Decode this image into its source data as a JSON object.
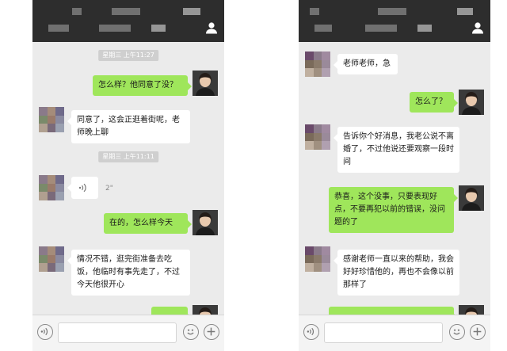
{
  "left_phone": {
    "messages": [
      {
        "kind": "timestamp",
        "text": "星期三 上午11:27"
      },
      {
        "kind": "out",
        "text": "怎么样？他同意了没？"
      },
      {
        "kind": "in",
        "text": "同意了，这会正逛着街呢，老师晚上聊"
      },
      {
        "kind": "timestamp",
        "text": "星期三 上午11:11"
      },
      {
        "kind": "voice",
        "duration": "2\""
      },
      {
        "kind": "out",
        "text": "在的，怎么样今天"
      },
      {
        "kind": "in",
        "text": "情况不错，逛完街准备去吃饭，他临时有事先走了，不过今天他很开心"
      },
      {
        "kind": "out",
        "text": ""
      }
    ]
  },
  "right_phone": {
    "messages": [
      {
        "kind": "in",
        "text": "老师老师，急"
      },
      {
        "kind": "out",
        "text": "怎么了？"
      },
      {
        "kind": "in",
        "text": "告诉你个好消息，我老公说不离婚了，不过他说还要观察一段时间"
      },
      {
        "kind": "out",
        "text": "恭喜，这个没事，只要表现好点，不要再犯以前的错误，没问题的了"
      },
      {
        "kind": "in",
        "text": "感谢老师一直以来的帮助，我会好好珍惜他的，再也不会像以前那样了"
      },
      {
        "kind": "out",
        "text": ""
      }
    ]
  },
  "icons": {
    "profile": "person-icon",
    "voice_toggle": "voice-wave-icon",
    "emoji": "emoji-smile-icon",
    "more": "plus-icon"
  },
  "colors": {
    "header": "#2d2d2d",
    "chat_bg": "#ebebeb",
    "outgoing_bubble": "#9fe65b",
    "incoming_bubble": "#ffffff"
  }
}
